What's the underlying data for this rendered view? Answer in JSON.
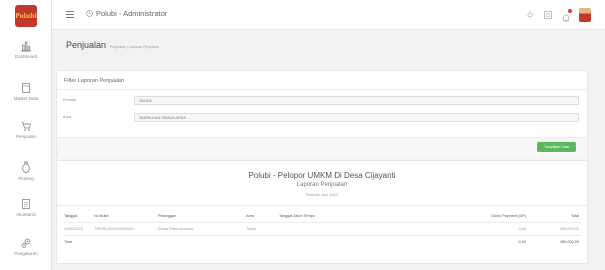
{
  "logo_text": "Polubi",
  "sidebar": {
    "items": [
      {
        "label": "Dashboard",
        "icon": "bar-chart-icon"
      },
      {
        "label": "Master Data",
        "icon": "folder-icon"
      },
      {
        "label": "Penjualan",
        "icon": "cart-icon"
      },
      {
        "label": "Piutang",
        "icon": "money-bag-icon"
      },
      {
        "label": "Akuntansi",
        "icon": "document-icon"
      },
      {
        "label": "Pengaturan",
        "icon": "gears-icon"
      }
    ]
  },
  "header": {
    "title": "Polubi - Administrator"
  },
  "page": {
    "title": "Penjualan",
    "breadcrumb": "Penjualan | Laporan Penjualan"
  },
  "filter": {
    "title": "Filter Laporan Penjualan",
    "period_label": "Periode",
    "period_value": "202306",
    "area_label": "Area",
    "area_value": "TAMPILKAN SEMUA AREA",
    "show_button": "Tampilkan Data"
  },
  "report": {
    "title": "Polubi - Pelopor UMKM Di Desa Cijayanti",
    "subtitle": "Laporan Penjualan",
    "period": "Periode Juni 2023",
    "columns": [
      "Tanggal",
      "No Bukti",
      "Pelanggan",
      "Area",
      "Tanggal Jatuh Tempo",
      "Down Payment (DP)",
      "Total"
    ],
    "rows": [
      [
        "21/06/2023",
        "TRX/SLS/2023/06/0001",
        "Shara Rana Annisaa",
        "Tokyo",
        "-",
        "0,00",
        "450.000,00"
      ]
    ],
    "total_row": [
      "Total",
      "0,00",
      "450.000,00"
    ]
  },
  "colors": {
    "accent_green": "#5cb85c",
    "logo_red": "#c0392b",
    "notification_red": "#e53935"
  }
}
